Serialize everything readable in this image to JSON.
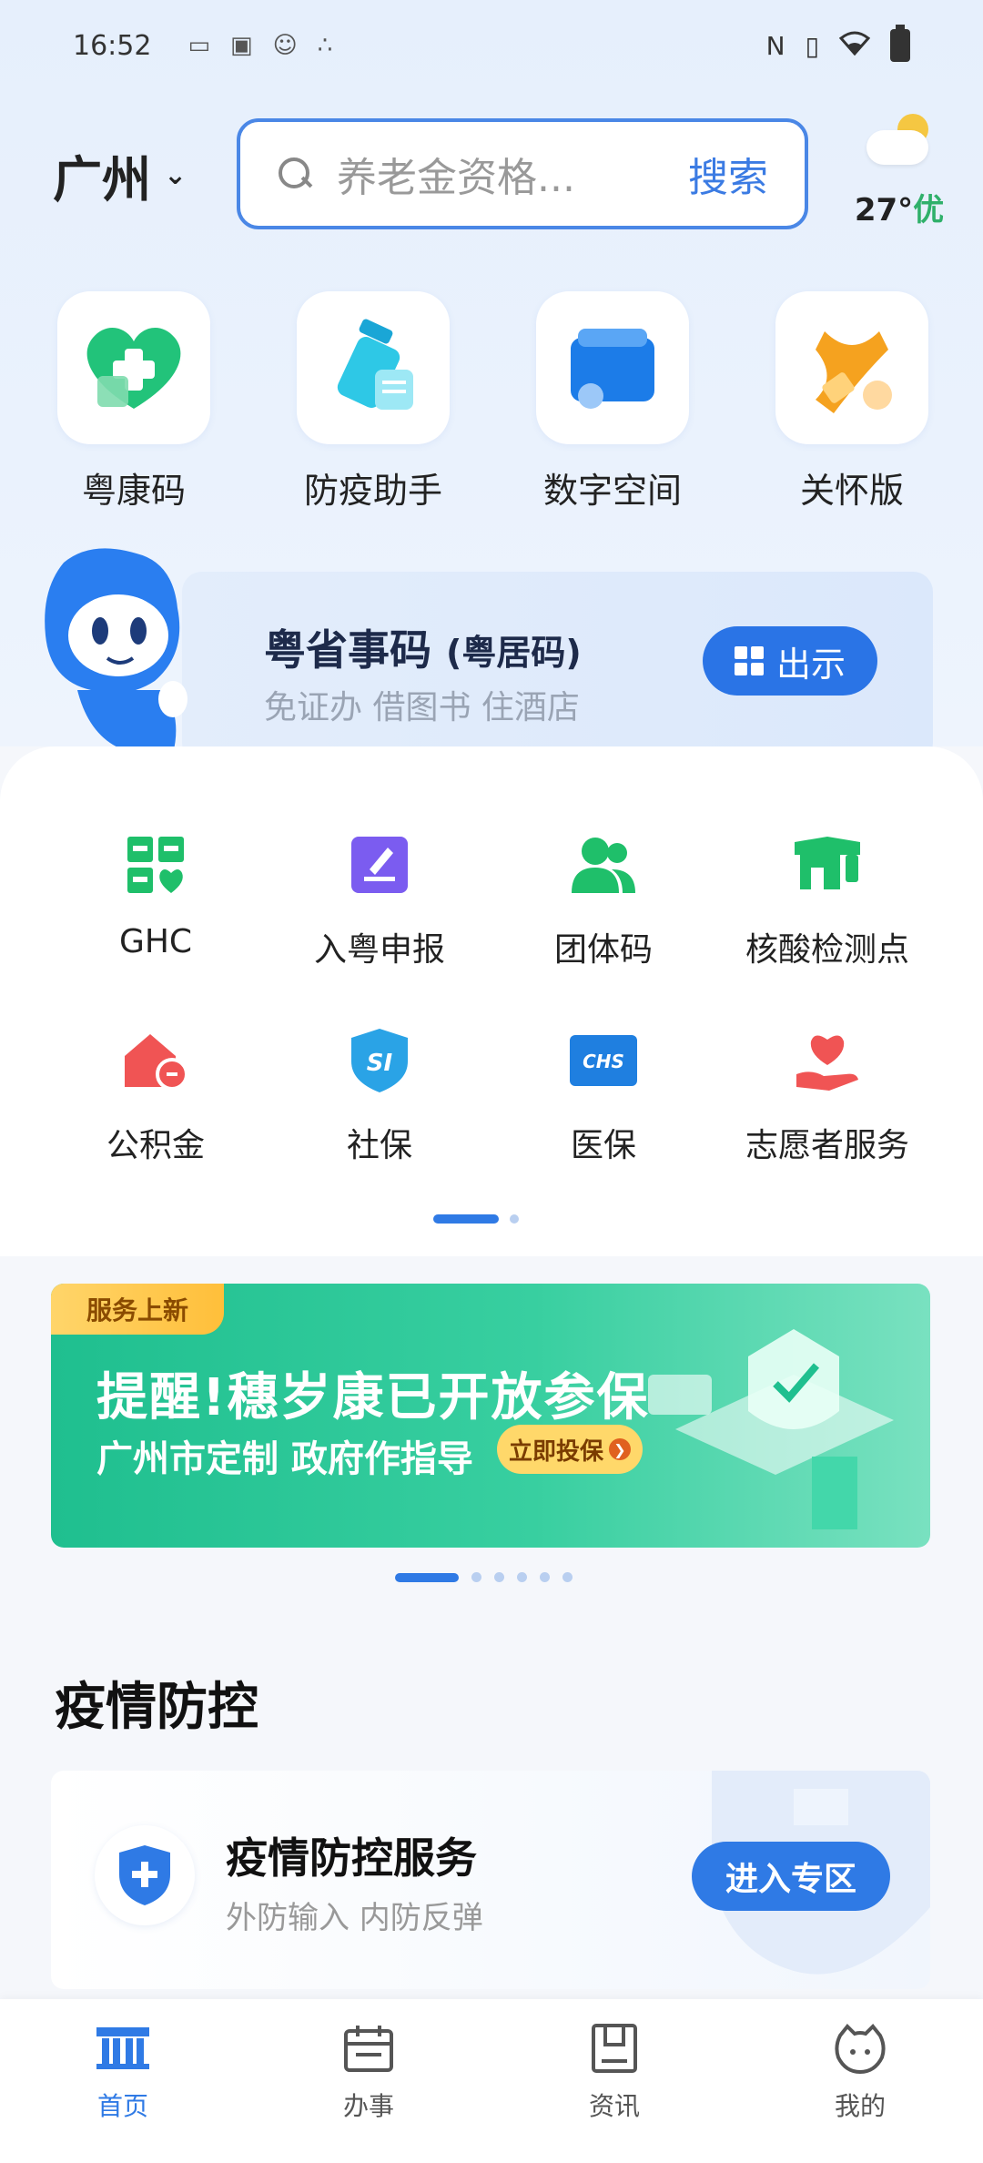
{
  "status_bar": {
    "time": "16:52",
    "left_icons": [
      "sim-icon",
      "app-notification-icon",
      "face-icon",
      "dots-icon"
    ],
    "right_icons": [
      "nfc-icon",
      "vibrate-icon",
      "wifi-icon",
      "battery-icon"
    ]
  },
  "header": {
    "city": "广州",
    "search_placeholder": "养老金资格...",
    "search_button": "搜索",
    "weather_temp": "27°",
    "air_quality": "优"
  },
  "quick_tiles": [
    {
      "label": "粤康码",
      "icon": "health-code-icon"
    },
    {
      "label": "防疫助手",
      "icon": "epidemic-assistant-icon"
    },
    {
      "label": "数字空间",
      "icon": "digital-space-icon"
    },
    {
      "label": "关怀版",
      "icon": "care-mode-icon"
    }
  ],
  "yue_banner": {
    "title": "粤省事码",
    "title_suffix": "(粤居码)",
    "subtitle": "免证办 借图书 住酒店",
    "button": "出示"
  },
  "services": [
    {
      "label": "GHC",
      "icon": "ghc-icon"
    },
    {
      "label": "入粤申报",
      "icon": "declaration-icon"
    },
    {
      "label": "团体码",
      "icon": "group-code-icon"
    },
    {
      "label": "核酸检测点",
      "icon": "test-site-icon"
    },
    {
      "label": "公积金",
      "icon": "housing-fund-icon"
    },
    {
      "label": "社保",
      "icon": "social-security-icon"
    },
    {
      "label": "医保",
      "icon": "medical-insurance-icon"
    },
    {
      "label": "志愿者服务",
      "icon": "volunteer-icon"
    }
  ],
  "promo": {
    "tag": "服务上新",
    "headline": "提醒!穗岁康已开放参保",
    "subline": "广州市定制 政府作指导",
    "cta": "立即投保"
  },
  "section": {
    "title": "疫情防控"
  },
  "epidemic_card": {
    "title": "疫情防控服务",
    "subtitle": "外防输入 内防反弹",
    "button": "进入专区"
  },
  "tabbar": [
    {
      "label": "首页",
      "icon": "home-icon",
      "active": true
    },
    {
      "label": "办事",
      "icon": "calendar-icon",
      "active": false
    },
    {
      "label": "资讯",
      "icon": "news-icon",
      "active": false
    },
    {
      "label": "我的",
      "icon": "profile-icon",
      "active": false
    }
  ],
  "colors": {
    "accent": "#2f7ae5",
    "green": "#1fbf8f"
  }
}
